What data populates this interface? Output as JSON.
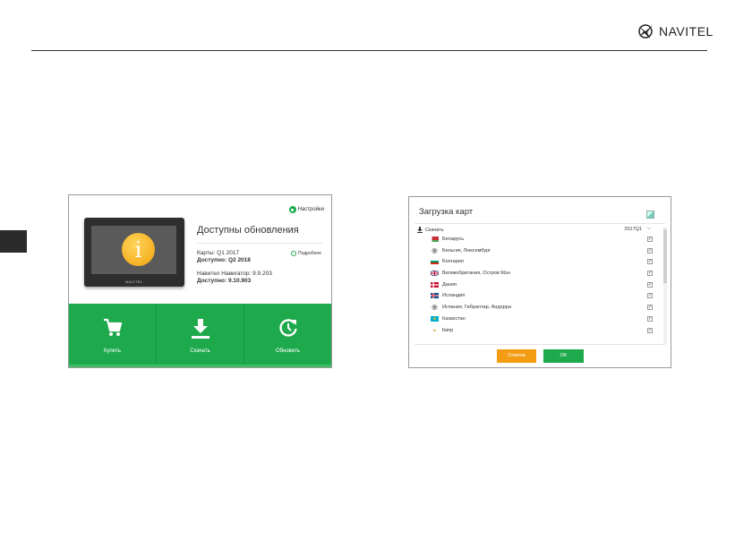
{
  "header": {
    "brand": "NAVITEL"
  },
  "update_window": {
    "settings_label": "Настройки",
    "device_brand": "NAVITEL",
    "title": "Доступны обновления",
    "maps_label": "Карты: Q1 2017",
    "maps_available": "Доступно: Q2 2018",
    "details_label": "Подробнее",
    "navigator_label": "Навител Навигатор: 9.9.203",
    "navigator_available": "Доступно: 9.10.903",
    "actions": [
      {
        "label": "Купить",
        "icon": "cart-icon"
      },
      {
        "label": "Скачать",
        "icon": "download-icon"
      },
      {
        "label": "Обновить",
        "icon": "refresh-icon"
      }
    ],
    "accent_color": "#1eaa4c"
  },
  "maps_window": {
    "title": "Загрузка карт",
    "download_label": "Скачать",
    "version": "2017Q1",
    "countries": [
      {
        "name": "Беларусь",
        "checked": "✓"
      },
      {
        "name": "Бельгия, Люксембург",
        "checked": "✓"
      },
      {
        "name": "Болгария",
        "checked": "✓"
      },
      {
        "name": "Великобритания, Остров Мэн",
        "checked": "✓"
      },
      {
        "name": "Дания",
        "checked": "✓"
      },
      {
        "name": "Исландия",
        "checked": "✓"
      },
      {
        "name": "Испания, Гибралтар, Андорра",
        "checked": "✓"
      },
      {
        "name": "Казахстан",
        "checked": "✓"
      },
      {
        "name": "Кипр",
        "checked": "✓"
      }
    ],
    "cancel_label": "Отмена",
    "ok_label": "OK",
    "cancel_color": "#f39c12",
    "ok_color": "#1eaa4c"
  }
}
